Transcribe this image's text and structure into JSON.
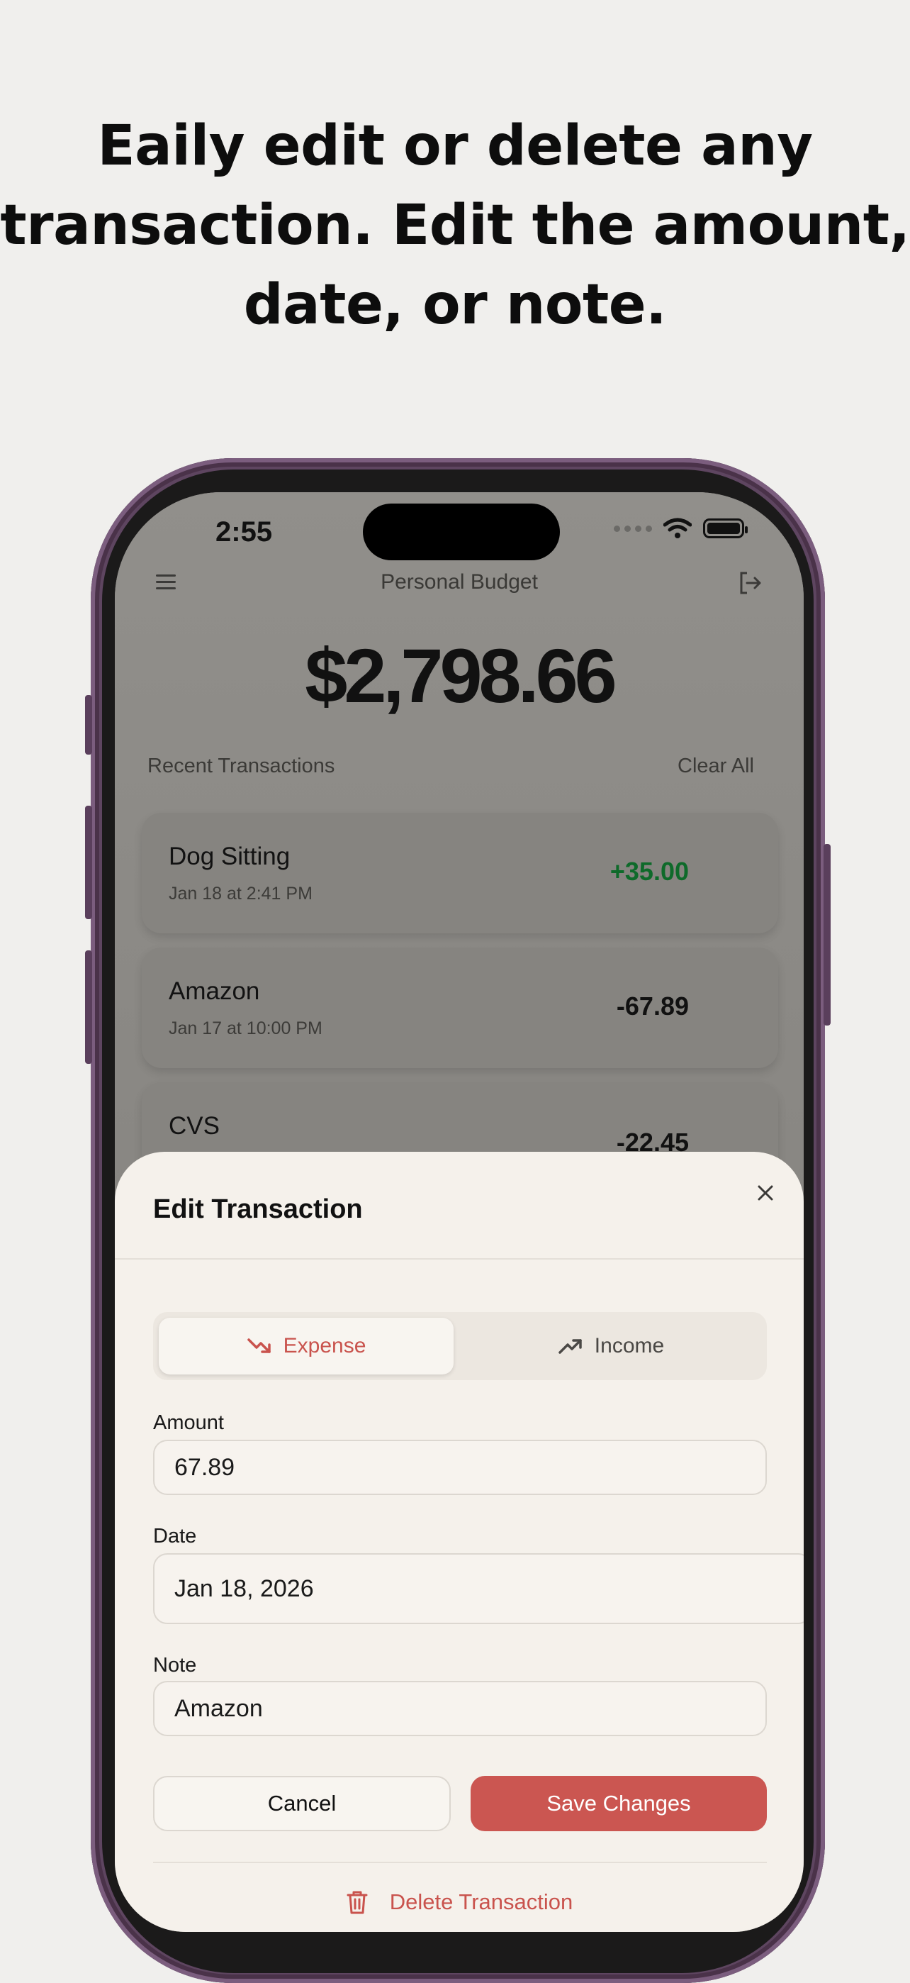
{
  "headline": {
    "line1": "Eaily edit or delete any",
    "line2": "transaction. Edit the amount,",
    "line3": "date, or note."
  },
  "status_bar": {
    "time": "2:55"
  },
  "nav": {
    "title": "Personal Budget"
  },
  "balance": "$2,798.66",
  "recent": {
    "heading": "Recent Transactions",
    "clear_label": "Clear All"
  },
  "transactions": [
    {
      "name": "Dog Sitting",
      "date": "Jan 18 at 2:41 PM",
      "amount": "+35.00"
    },
    {
      "name": "Amazon",
      "date": "Jan 17 at 10:00 PM",
      "amount": "-67.89"
    },
    {
      "name": "CVS",
      "date": "",
      "amount": "-22.45"
    }
  ],
  "sheet": {
    "title": "Edit Transaction",
    "type_toggle": {
      "expense": "Expense",
      "income": "Income",
      "selected": "Expense"
    },
    "amount_label": "Amount",
    "amount_value": "67.89",
    "date_label": "Date",
    "date_value": "Jan 18, 2026",
    "note_label": "Note",
    "note_value": "Amazon",
    "cancel_label": "Cancel",
    "save_label": "Save Changes",
    "delete_label": "Delete Transaction"
  },
  "colors": {
    "accent_red": "#cb5651",
    "income_green": "#0e6a2a",
    "phone_frame": "#5e4560",
    "sheet_bg": "#f5f1eb"
  }
}
